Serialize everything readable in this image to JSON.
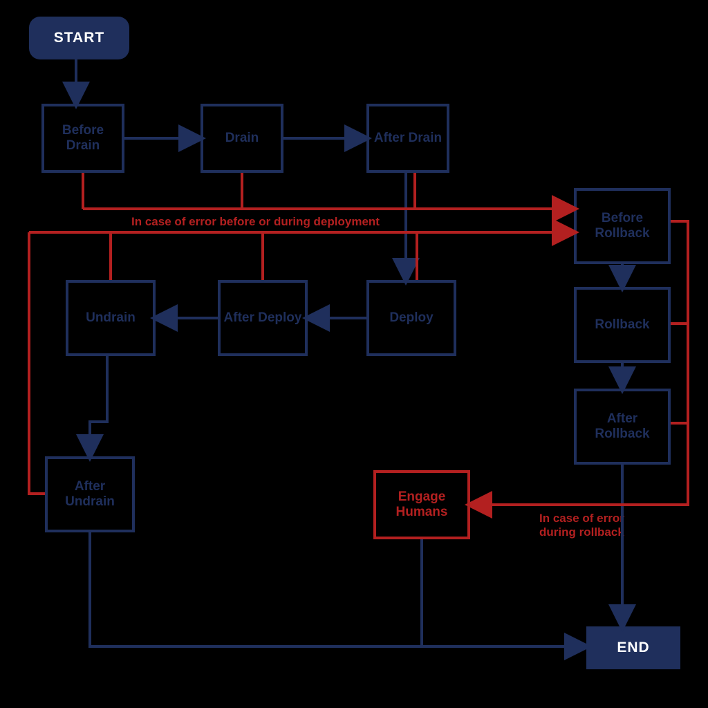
{
  "terminals": {
    "start": "START",
    "end": "END"
  },
  "nodes": {
    "beforeDrain": "Before Drain",
    "drain": "Drain",
    "afterDrain": "After Drain",
    "deploy": "Deploy",
    "afterDeploy": "After Deploy",
    "undrain": "Undrain",
    "afterUndrain": "After Undrain",
    "beforeRollback": "Before Rollback",
    "rollback": "Rollback",
    "afterRollback": "After Rollback",
    "engageHumans": "Engage Humans"
  },
  "labels": {
    "errDeploy": "In case of error before or during deployment",
    "errRollback": "In case of error during rollback"
  }
}
